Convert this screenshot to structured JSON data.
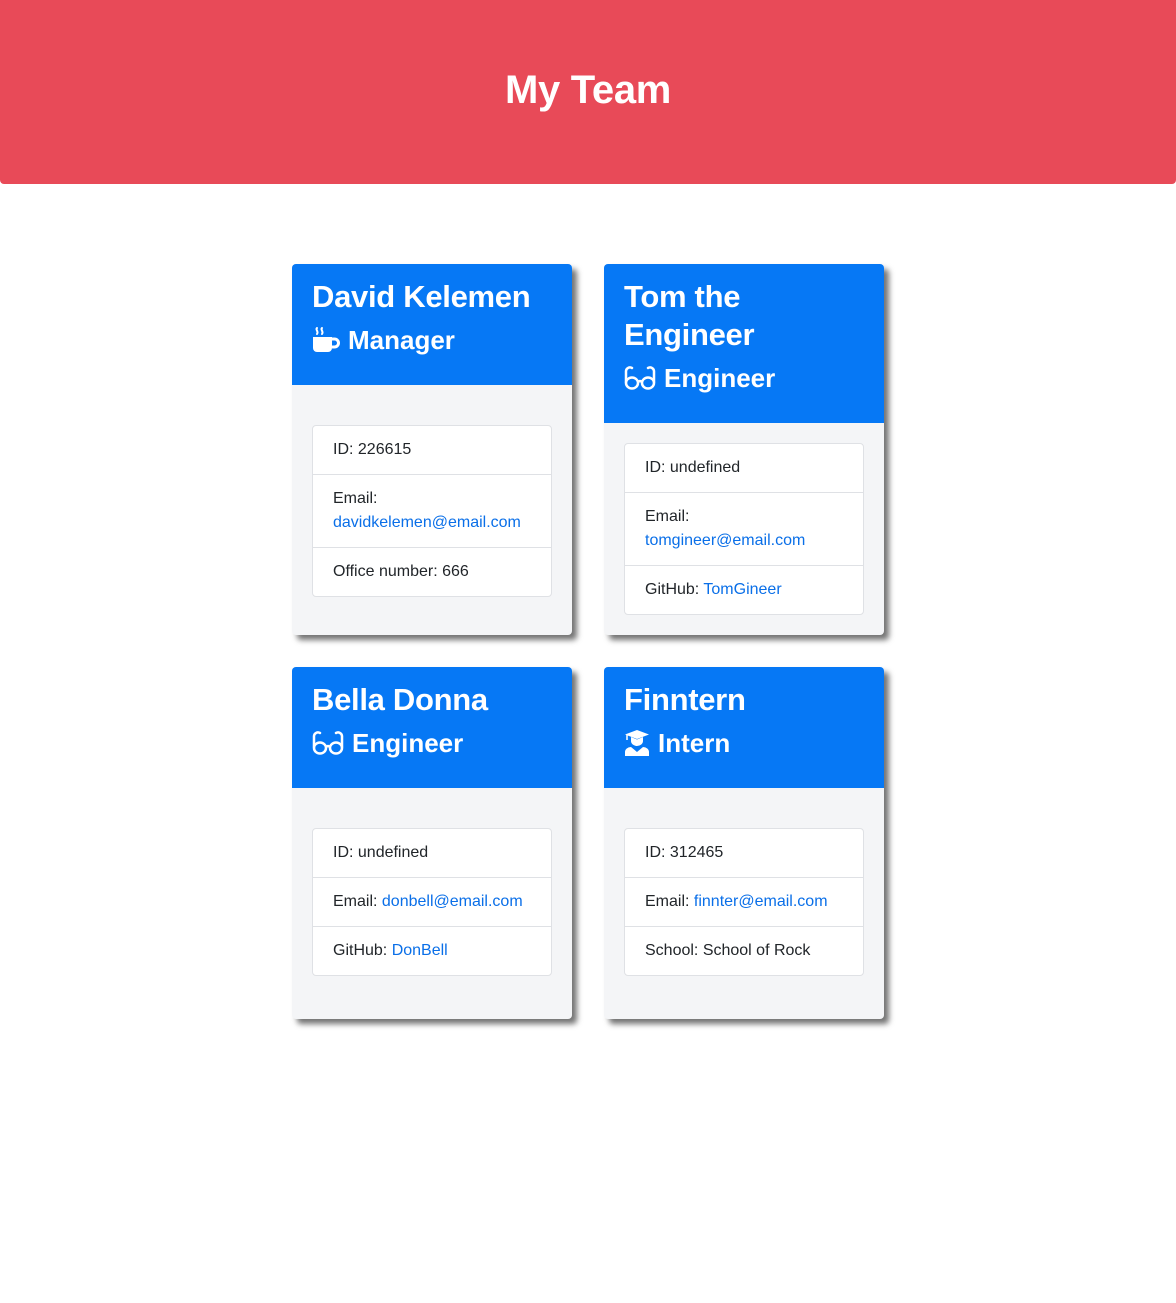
{
  "header": {
    "title": "My Team"
  },
  "colors": {
    "header_bg": "#e84a58",
    "card_header_bg": "#0678f5",
    "link": "#0a6fe8"
  },
  "cards": [
    {
      "name": "David Kelemen",
      "role": "Manager",
      "role_icon": "coffee-mug-icon",
      "id_label": "ID: ",
      "id": "226615",
      "email_label": "Email:",
      "email": "davidkelemen@email.com",
      "extra_label": "Office number: ",
      "extra_value": "666"
    },
    {
      "name": "Tom the Engineer",
      "role": "Engineer",
      "role_icon": "glasses-icon",
      "id_label": "ID: ",
      "id": "undefined",
      "email_label": "Email:",
      "email": "tomgineer@email.com",
      "extra_label": "GitHub: ",
      "extra_value": "TomGineer"
    },
    {
      "name": "Bella Donna",
      "role": "Engineer",
      "role_icon": "glasses-icon",
      "id_label": "ID: ",
      "id": "undefined",
      "email_label": "Email: ",
      "email": "donbell@email.com",
      "extra_label": "GitHub: ",
      "extra_value": "DonBell"
    },
    {
      "name": "Finntern",
      "role": "Intern",
      "role_icon": "graduate-icon",
      "id_label": "ID: ",
      "id": "312465",
      "email_label": "Email: ",
      "email": "finnter@email.com",
      "extra_label": "School: ",
      "extra_value": "School of Rock"
    }
  ]
}
